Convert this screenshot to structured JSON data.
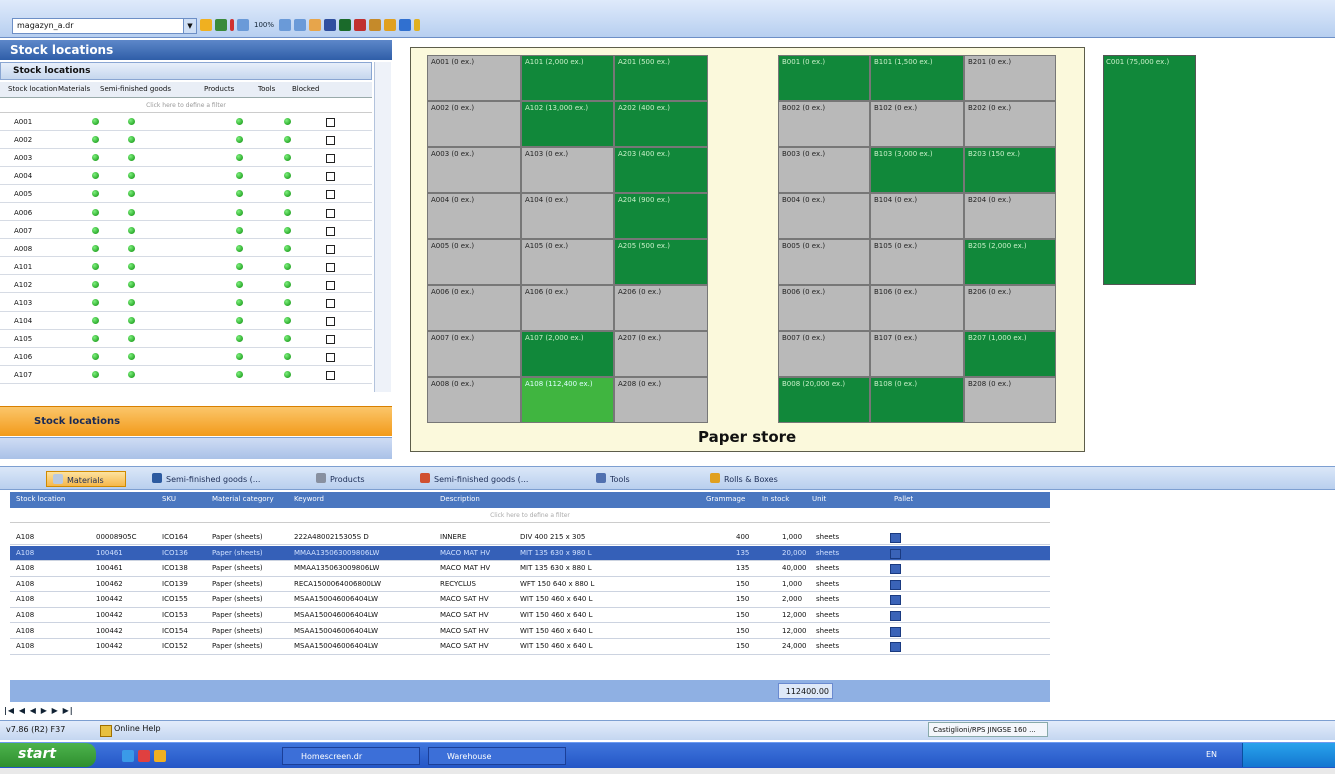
{
  "toolbar": {
    "file_name": "magazyn_a.dr",
    "zoom": "100%"
  },
  "left_panel": {
    "title": "Stock locations",
    "subtitle": "Stock locations",
    "columns": [
      "Stock location",
      "Materials",
      "Semi-finished goods",
      "Products",
      "Tools",
      "Blocked"
    ],
    "filter_placeholder": "Click here to define a filter",
    "rows": [
      {
        "loc": "A001"
      },
      {
        "loc": "A002"
      },
      {
        "loc": "A003"
      },
      {
        "loc": "A004"
      },
      {
        "loc": "A005"
      },
      {
        "loc": "A006"
      },
      {
        "loc": "A007"
      },
      {
        "loc": "A008"
      },
      {
        "loc": "A101"
      },
      {
        "loc": "A102"
      },
      {
        "loc": "A103"
      },
      {
        "loc": "A104"
      },
      {
        "loc": "A105"
      },
      {
        "loc": "A106"
      },
      {
        "loc": "A107"
      }
    ],
    "orange_button": "Stock locations"
  },
  "map": {
    "title": "Paper store",
    "cells": [
      {
        "label": "A001 (0 ex.)",
        "state": "s",
        "col": 0,
        "row": 0
      },
      {
        "label": "A101 (2,000 ex.)",
        "state": "g",
        "col": 1,
        "row": 0
      },
      {
        "label": "A201 (500 ex.)",
        "state": "g",
        "col": 2,
        "row": 0
      },
      {
        "label": "A002 (0 ex.)",
        "state": "s",
        "col": 0,
        "row": 1
      },
      {
        "label": "A102 (13,000 ex.)",
        "state": "g",
        "col": 1,
        "row": 1
      },
      {
        "label": "A202 (400 ex.)",
        "state": "g",
        "col": 2,
        "row": 1
      },
      {
        "label": "A003 (0 ex.)",
        "state": "s",
        "col": 0,
        "row": 2
      },
      {
        "label": "A103 (0 ex.)",
        "state": "s",
        "col": 1,
        "row": 2
      },
      {
        "label": "A203 (400 ex.)",
        "state": "g",
        "col": 2,
        "row": 2
      },
      {
        "label": "A004 (0 ex.)",
        "state": "s",
        "col": 0,
        "row": 3
      },
      {
        "label": "A104 (0 ex.)",
        "state": "s",
        "col": 1,
        "row": 3
      },
      {
        "label": "A204 (900 ex.)",
        "state": "g",
        "col": 2,
        "row": 3
      },
      {
        "label": "A005 (0 ex.)",
        "state": "s",
        "col": 0,
        "row": 4
      },
      {
        "label": "A105 (0 ex.)",
        "state": "s",
        "col": 1,
        "row": 4
      },
      {
        "label": "A205 (500 ex.)",
        "state": "g",
        "col": 2,
        "row": 4
      },
      {
        "label": "A006 (0 ex.)",
        "state": "s",
        "col": 0,
        "row": 5
      },
      {
        "label": "A106 (0 ex.)",
        "state": "s",
        "col": 1,
        "row": 5
      },
      {
        "label": "A206 (0 ex.)",
        "state": "s",
        "col": 2,
        "row": 5
      },
      {
        "label": "A007 (0 ex.)",
        "state": "s",
        "col": 0,
        "row": 6
      },
      {
        "label": "A107 (2,000 ex.)",
        "state": "g",
        "col": 1,
        "row": 6
      },
      {
        "label": "A207 (0 ex.)",
        "state": "s",
        "col": 2,
        "row": 6
      },
      {
        "label": "A008 (0 ex.)",
        "state": "s",
        "col": 0,
        "row": 7
      },
      {
        "label": "A108 (112,400 ex.)",
        "state": "lg",
        "col": 1,
        "row": 7
      },
      {
        "label": "A208 (0 ex.)",
        "state": "s",
        "col": 2,
        "row": 7
      },
      {
        "label": "B001 (0 ex.)",
        "state": "g",
        "col": 3,
        "row": 0
      },
      {
        "label": "B101 (1,500 ex.)",
        "state": "g",
        "col": 4,
        "row": 0
      },
      {
        "label": "B201 (0 ex.)",
        "state": "s",
        "col": 5,
        "row": 0
      },
      {
        "label": "B002 (0 ex.)",
        "state": "s",
        "col": 3,
        "row": 1
      },
      {
        "label": "B102 (0 ex.)",
        "state": "s",
        "col": 4,
        "row": 1
      },
      {
        "label": "B202 (0 ex.)",
        "state": "s",
        "col": 5,
        "row": 1
      },
      {
        "label": "B003 (0 ex.)",
        "state": "s",
        "col": 3,
        "row": 2
      },
      {
        "label": "B103 (3,000 ex.)",
        "state": "g",
        "col": 4,
        "row": 2
      },
      {
        "label": "B203 (150 ex.)",
        "state": "g",
        "col": 5,
        "row": 2
      },
      {
        "label": "B004 (0 ex.)",
        "state": "s",
        "col": 3,
        "row": 3
      },
      {
        "label": "B104 (0 ex.)",
        "state": "s",
        "col": 4,
        "row": 3
      },
      {
        "label": "B204 (0 ex.)",
        "state": "s",
        "col": 5,
        "row": 3
      },
      {
        "label": "B005 (0 ex.)",
        "state": "s",
        "col": 3,
        "row": 4
      },
      {
        "label": "B105 (0 ex.)",
        "state": "s",
        "col": 4,
        "row": 4
      },
      {
        "label": "B205 (2,000 ex.)",
        "state": "g",
        "col": 5,
        "row": 4
      },
      {
        "label": "B006 (0 ex.)",
        "state": "s",
        "col": 3,
        "row": 5
      },
      {
        "label": "B106 (0 ex.)",
        "state": "s",
        "col": 4,
        "row": 5
      },
      {
        "label": "B206 (0 ex.)",
        "state": "s",
        "col": 5,
        "row": 5
      },
      {
        "label": "B007 (0 ex.)",
        "state": "s",
        "col": 3,
        "row": 6
      },
      {
        "label": "B107 (0 ex.)",
        "state": "s",
        "col": 4,
        "row": 6
      },
      {
        "label": "B207 (1,000 ex.)",
        "state": "g",
        "col": 5,
        "row": 6
      },
      {
        "label": "B008 (20,000 ex.)",
        "state": "g",
        "col": 3,
        "row": 7
      },
      {
        "label": "B108 (0 ex.)",
        "state": "g",
        "col": 4,
        "row": 7
      },
      {
        "label": "B208 (0 ex.)",
        "state": "s",
        "col": 5,
        "row": 7
      }
    ],
    "extra_label": "C001 (75,000 ex.)"
  },
  "tabs": [
    "Materials",
    "Semi-finished goods (...",
    "Products",
    "Semi-finished goods (...",
    "Tools",
    "Rolls & Boxes"
  ],
  "grid": {
    "columns": [
      "Stock location",
      "",
      "SKU",
      "Material category",
      "Keyword",
      "Description",
      "Grammage",
      "In stock",
      "Unit",
      "Pallet"
    ],
    "filter_placeholder": "Click here to define a filter",
    "rows": [
      {
        "loc": "A108",
        "id": "00008905C",
        "sku": "ICO164",
        "cat": "Paper (sheets)",
        "kw": "222A4800215305S D",
        "desc1": "INNERE",
        "desc2": "DIV 400 215 x 305",
        "gram": "400",
        "qty": "1,000",
        "unit": "sheets"
      },
      {
        "loc": "A108",
        "id": "100461",
        "sku": "ICO136",
        "cat": "Paper (sheets)",
        "kw": "MMAA135063009806LW",
        "desc1": "MACO MAT HV",
        "desc2": "MIT 135 630 x 980 L",
        "gram": "135",
        "qty": "20,000",
        "unit": "sheets"
      },
      {
        "loc": "A108",
        "id": "100461",
        "sku": "ICO138",
        "cat": "Paper (sheets)",
        "kw": "MMAA135063009806LW",
        "desc1": "MACO MAT HV",
        "desc2": "MIT 135 630 x 880 L",
        "gram": "135",
        "qty": "40,000",
        "unit": "sheets"
      },
      {
        "loc": "A108",
        "id": "100462",
        "sku": "ICO139",
        "cat": "Paper (sheets)",
        "kw": "RECA1500064006800LW",
        "desc1": "RECYCLUS",
        "desc2": "WFT 150 640 x 880 L",
        "gram": "150",
        "qty": "1,000",
        "unit": "sheets"
      },
      {
        "loc": "A108",
        "id": "100442",
        "sku": "ICO155",
        "cat": "Paper (sheets)",
        "kw": "MSAA150046006404LW",
        "desc1": "MACO SAT HV",
        "desc2": "WIT 150 460 x 640 L",
        "gram": "150",
        "qty": "2,000",
        "unit": "sheets"
      },
      {
        "loc": "A108",
        "id": "100442",
        "sku": "ICO153",
        "cat": "Paper (sheets)",
        "kw": "MSAA150046006404LW",
        "desc1": "MACO SAT HV",
        "desc2": "WIT 150 460 x 640 L",
        "gram": "150",
        "qty": "12,000",
        "unit": "sheets"
      },
      {
        "loc": "A108",
        "id": "100442",
        "sku": "ICO154",
        "cat": "Paper (sheets)",
        "kw": "MSAA150046006404LW",
        "desc1": "MACO SAT HV",
        "desc2": "WIT 150 460 x 640 L",
        "gram": "150",
        "qty": "12,000",
        "unit": "sheets"
      },
      {
        "loc": "A108",
        "id": "100442",
        "sku": "ICO152",
        "cat": "Paper (sheets)",
        "kw": "MSAA150046006404LW",
        "desc1": "MACO SAT HV",
        "desc2": "WIT 150 460 x 640 L",
        "gram": "150",
        "qty": "24,000",
        "unit": "sheets"
      }
    ],
    "total": "112400.00"
  },
  "nav": "|◀ ◀ ◀ ▶ ▶ ▶|",
  "status": {
    "version": "v7.86 (R2) F37",
    "help": "Online Help",
    "right": "Castiglioni/RPS JINGSE 160 ..."
  },
  "taskbar": {
    "start": "start",
    "task1": "Homescreen.dr",
    "task2": "Warehouse",
    "tray_text": "EN"
  }
}
